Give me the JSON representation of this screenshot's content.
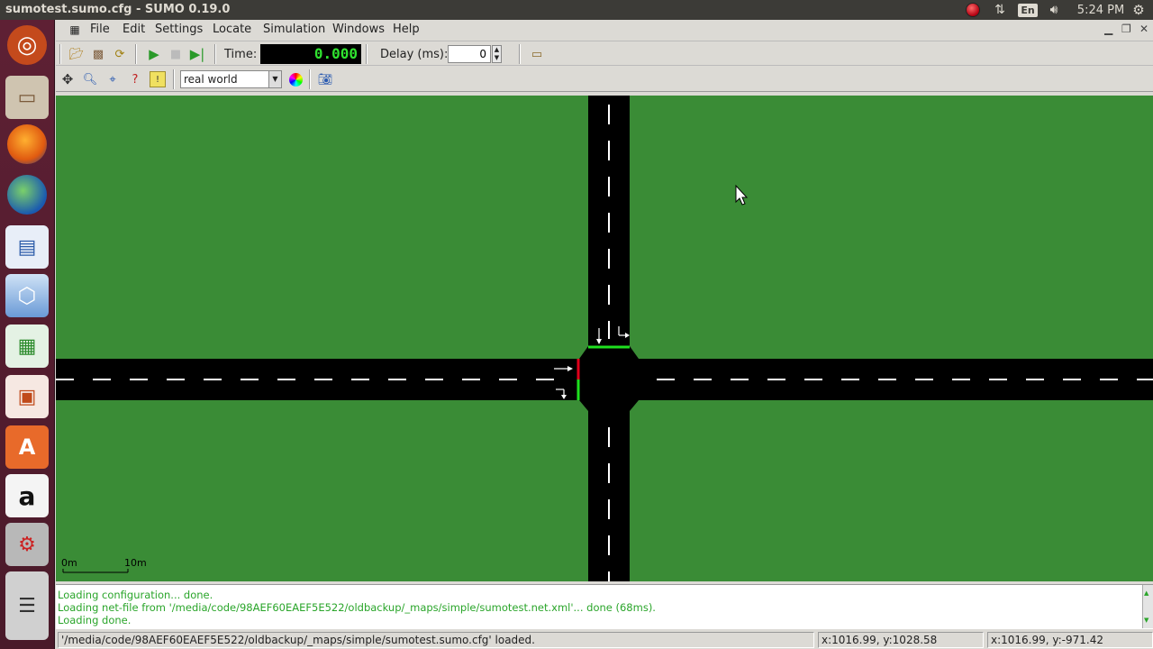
{
  "topbar": {
    "title": "sumotest.sumo.cfg - SUMO 0.19.0",
    "lang": "En",
    "clock": "5:24 PM"
  },
  "menu": {
    "file": "File",
    "edit": "Edit",
    "settings": "Settings",
    "locate": "Locate",
    "simulation": "Simulation",
    "windows": "Windows",
    "help": "Help"
  },
  "toolbar": {
    "time_label": "Time:",
    "time_value": "0.000",
    "delay_label": "Delay (ms):",
    "delay_value": "0",
    "scheme": "real world"
  },
  "scale": {
    "start": "0m",
    "end": "10m"
  },
  "messages": [
    "Loading configuration... done.",
    "Loading net-file from '/media/code/98AEF60EAEF5E522/oldbackup/_maps/simple/sumotest.net.xml'...  done (68ms).",
    "Loading done."
  ],
  "status": {
    "message": "'/media/code/98AEF60EAEF5E522/oldbackup/_maps/simple/sumotest.sumo.cfg' loaded.",
    "coord1": "x:1016.99, y:1028.58",
    "coord2": "x:1016.99, y:-971.42"
  },
  "colors": {
    "grass": "#3a8c36",
    "road": "#000000",
    "signal_red": "#e0001a",
    "signal_green": "#1ee01e",
    "launcher": "#5e2034"
  },
  "launcher_icons": [
    "ubuntu-dash-icon",
    "files-icon",
    "firefox-icon",
    "globe-icon",
    "writer-icon",
    "cube-icon",
    "calc-icon",
    "impress-icon",
    "software-center-icon",
    "amazon-icon",
    "settings-icon",
    "stack-icon"
  ]
}
